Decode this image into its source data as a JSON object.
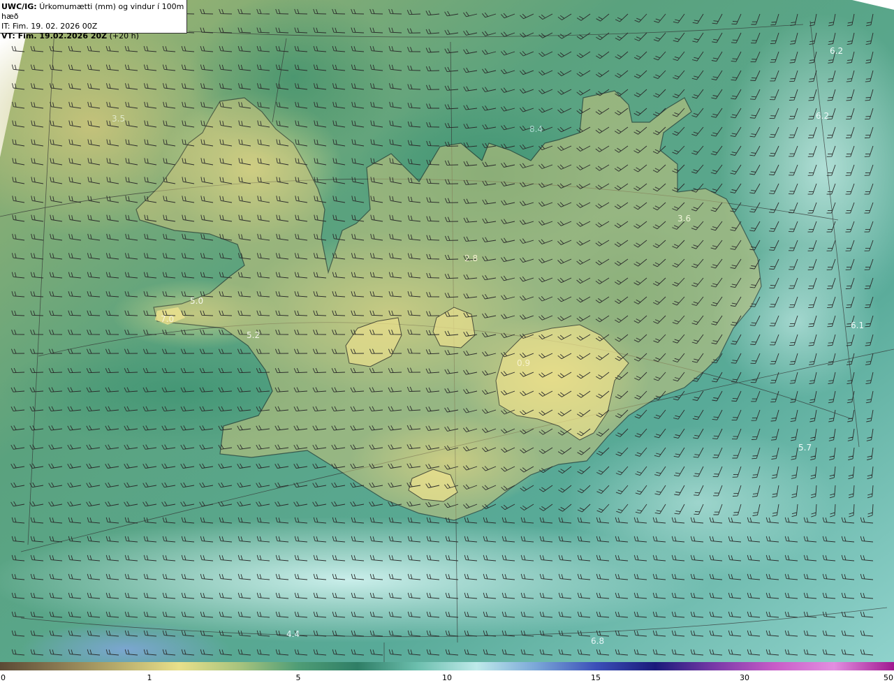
{
  "header": {
    "product_code": "UWC/IG:",
    "product_title": "Úrkomumætti (mm) og vindur í 100m hæð",
    "init_time": "IT: Fim. 19. 02. 2026 00Z",
    "valid_prefix": "VT: Fim. 19.02.2026 20Z",
    "valid_lead": "(+20 h)"
  },
  "map_labels": [
    "3.5",
    "8.4",
    "6.2",
    "6.2",
    "3.6",
    "2.8",
    "5.0",
    "7.0",
    "5.2",
    "6.1",
    "0.9",
    "5.7",
    "4.4",
    "6.8"
  ],
  "colorbar": {
    "ticks": [
      "0",
      "1",
      "5",
      "10",
      "15",
      "30",
      "50"
    ],
    "stops": [
      "#5b4a35",
      "#8b7a52",
      "#b8ad6c",
      "#e8e08a",
      "#a9c47e",
      "#4f9d76",
      "#2f7e66",
      "#6cbfae",
      "#bfeaea",
      "#7aa6d8",
      "#3b4fb8",
      "#1a1a7a",
      "#7a3aa8",
      "#c85cc8",
      "#e28ee0",
      "#a01890"
    ]
  },
  "colors": {
    "land_light": "#e2d886",
    "land_mid": "#9fbf78",
    "sea_green": "#3f9478",
    "sea_teal": "#6ab7a8",
    "sea_pale": "#b8e8e6",
    "sea_blue": "#7fa9d6",
    "coastline": "#1e1e1e",
    "barb": "#2a2a2a"
  }
}
